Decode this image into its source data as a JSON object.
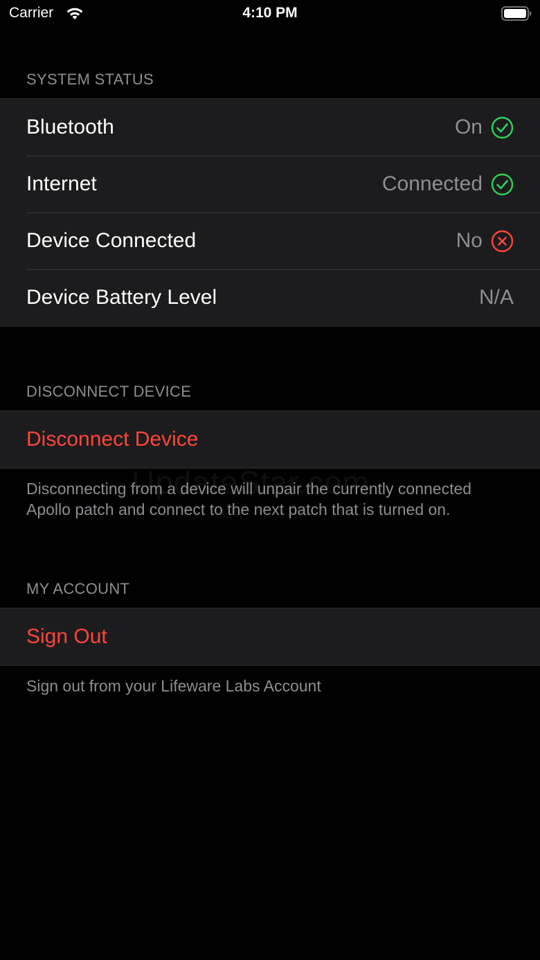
{
  "status_bar": {
    "carrier": "Carrier",
    "time": "4:10 PM",
    "icons": [
      "wifi-icon",
      "battery-icon"
    ]
  },
  "system_status": {
    "header": "SYSTEM STATUS",
    "rows": [
      {
        "label": "Bluetooth",
        "value": "On",
        "icon": "check-circle-icon",
        "icon_color": "#30d158"
      },
      {
        "label": "Internet",
        "value": "Connected",
        "icon": "check-circle-icon",
        "icon_color": "#30d158"
      },
      {
        "label": "Device Connected",
        "value": "No",
        "icon": "x-circle-icon",
        "icon_color": "#ff453a"
      },
      {
        "label": "Device Battery Level",
        "value": "N/A"
      }
    ]
  },
  "disconnect": {
    "header": "DISCONNECT DEVICE",
    "action_label": "Disconnect Device",
    "footer": "Disconnecting from a device will unpair the currently connected Apollo patch and connect to the next patch that is turned on."
  },
  "account": {
    "header": "MY ACCOUNT",
    "action_label": "Sign Out",
    "footer": "Sign out from your Lifeware Labs Account"
  },
  "watermark": "UpdateStar.com",
  "colors": {
    "background": "#000000",
    "cell": "#1c1c1e",
    "secondary_text": "#8e8e93",
    "destructive": "#ff453a",
    "success": "#30d158"
  }
}
